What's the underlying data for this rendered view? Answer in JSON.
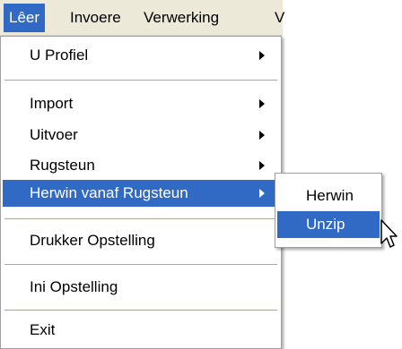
{
  "menubar": {
    "items": [
      "Lêer",
      "Invoere",
      "Verwerking",
      "V"
    ]
  },
  "main_menu": {
    "items": [
      {
        "label": "U Profiel",
        "submenu": true
      },
      {
        "label": "Import",
        "submenu": true
      },
      {
        "label": "Uitvoer",
        "submenu": true
      },
      {
        "label": "Rugsteun",
        "submenu": true
      },
      {
        "label": "Herwin vanaf Rugsteun",
        "submenu": true,
        "highlighted": true
      },
      {
        "label": "Drukker Opstelling",
        "submenu": false
      },
      {
        "label": "Ini Opstelling",
        "submenu": false
      },
      {
        "label": "Exit",
        "submenu": false
      }
    ]
  },
  "sub_menu": {
    "items": [
      {
        "label": "Herwin"
      },
      {
        "label": "Unzip",
        "highlighted": true
      }
    ]
  },
  "colors": {
    "highlight": "#316ac5",
    "menubar_bg": "#ece9d8"
  },
  "icons": {
    "cursor": "arrow-pointer-icon",
    "submenu_arrow": "submenu-arrow-icon"
  }
}
